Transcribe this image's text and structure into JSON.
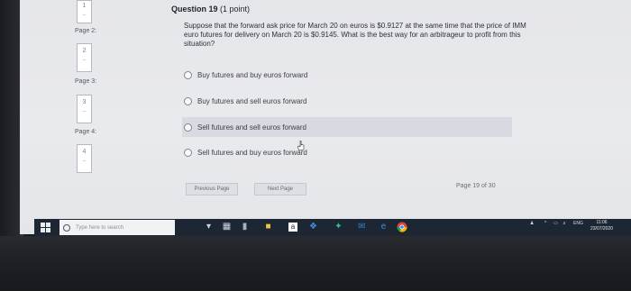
{
  "sidebar": {
    "pages": [
      {
        "label": "",
        "thumb": "1"
      },
      {
        "label": "Page 2:",
        "thumb": "2"
      },
      {
        "label": "Page 3:",
        "thumb": "3"
      },
      {
        "label": "Page 4:",
        "thumb": "4"
      }
    ]
  },
  "question": {
    "title_bold": "Question 19",
    "title_points": "(1 point)",
    "text": "Suppose that the forward ask price for March 20 on euros is $0.9127 at the same time that the price of IMM euro futures for delivery on March 20 is $0.9145. What is the best way for an arbitrageur to profit from this situation?",
    "options": [
      "Buy futures and buy euros forward",
      "Buy futures and sell euros forward",
      "Sell futures and sell euros forward",
      "Sell futures and buy euros forward"
    ],
    "highlighted_option_index": 2
  },
  "nav": {
    "prev_label": "Previous Page",
    "next_label": "Next Page",
    "page_count": "Page 19 of 30"
  },
  "taskbar": {
    "search_placeholder": "Type here to search",
    "language": "ENG",
    "time": "11:06",
    "date": "23/07/2020",
    "icons": [
      "task-view-icon",
      "cortana-icon",
      "file-explorer-icon",
      "store-icon",
      "amazon-icon",
      "dropbox-icon",
      "kaspersky-icon",
      "mail-icon",
      "edge-icon",
      "chrome-icon"
    ]
  },
  "colors": {
    "taskbar": "#1d2733",
    "highlight": "#d7dae0",
    "screen": "#e7e8eb"
  }
}
